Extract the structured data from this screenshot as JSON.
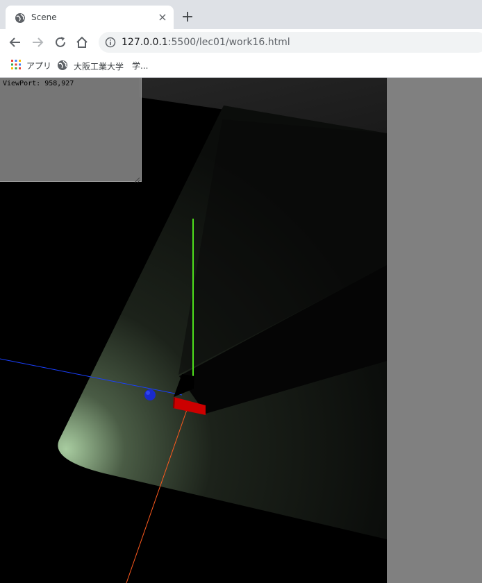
{
  "browser": {
    "tab_title": "Scene",
    "tab_close_glyph": "×",
    "new_tab_glyph": "+",
    "url_host": "127.0.0.1",
    "url_rest": ":5500/lec01/work16.html",
    "bookmarks": [
      {
        "label": "アプリ",
        "icon": "apps-grid-icon"
      },
      {
        "label": "大阪工業大学",
        "icon": "globe-icon"
      },
      {
        "label": "学...",
        "icon": ""
      }
    ]
  },
  "overlay": {
    "viewport_label": "ViewPort: 958,927"
  },
  "scene": {
    "background_color": "#000000",
    "axis_colors": {
      "x": "#ff5a1e",
      "y": "#4ee01c",
      "z": "#1a40ff"
    },
    "box_color": "#cc0000",
    "sphere_color": "#1a2acc",
    "light_color": "#a8cca0"
  }
}
